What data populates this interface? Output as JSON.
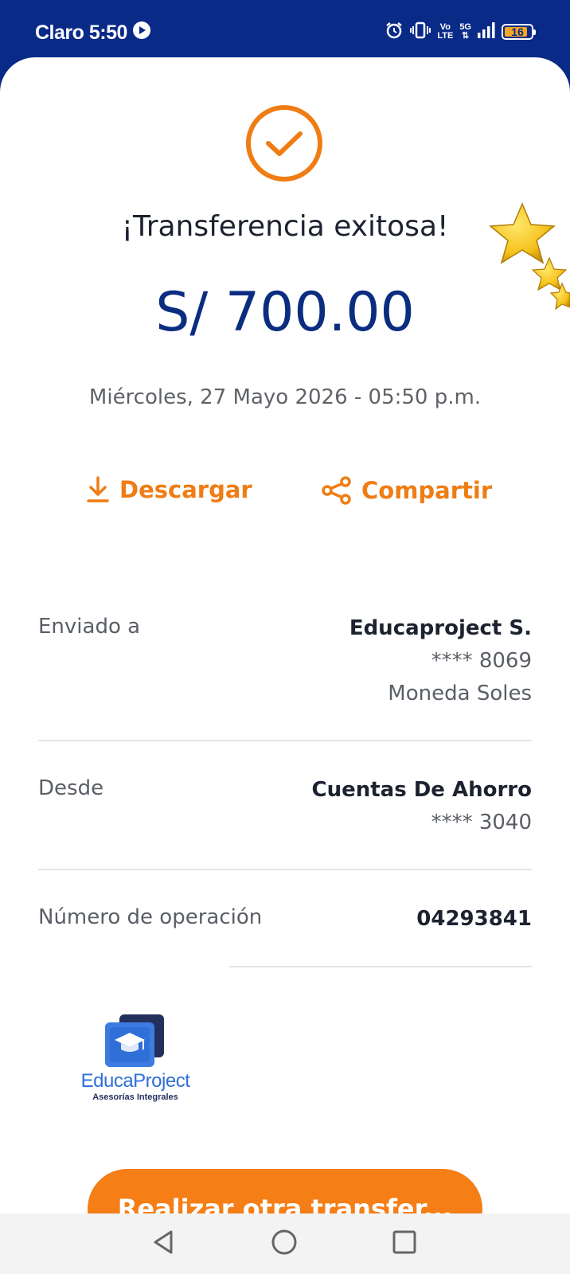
{
  "status_bar": {
    "carrier_time": "Claro 5:50",
    "network_top": "Vo",
    "network_bottom": "LTE",
    "generation": "5G",
    "battery_level": "16",
    "icons": [
      "play-icon",
      "alarm-icon",
      "vibrate-icon",
      "signal-icon",
      "battery-icon"
    ]
  },
  "receipt": {
    "success_icon": "check-circle-icon",
    "title": "¡Transferencia exitosa!",
    "amount": "S/ 700.00",
    "date": "Miércoles, 27 Mayo 2026 - 05:50 p.m.",
    "accent_color": "#ef7d14",
    "amount_color": "#0b2d80"
  },
  "actions": {
    "download_label": "Descargar",
    "share_label": "Compartir"
  },
  "details": {
    "sent_to": {
      "label": "Enviado a",
      "name": "Educaproject S.",
      "account": "**** 8069",
      "currency": "Moneda Soles"
    },
    "from": {
      "label": "Desde",
      "name": "Cuentas De Ahorro",
      "account": "**** 3040"
    },
    "operation": {
      "label": "Número de operación",
      "value": "04293841"
    }
  },
  "logo": {
    "brand": "EducaProject",
    "tagline": "Asesorías Integrales"
  },
  "cta": {
    "label": "Realizar otra transfer..."
  },
  "nav": {
    "buttons": [
      "back-icon",
      "home-icon",
      "recents-icon"
    ]
  }
}
